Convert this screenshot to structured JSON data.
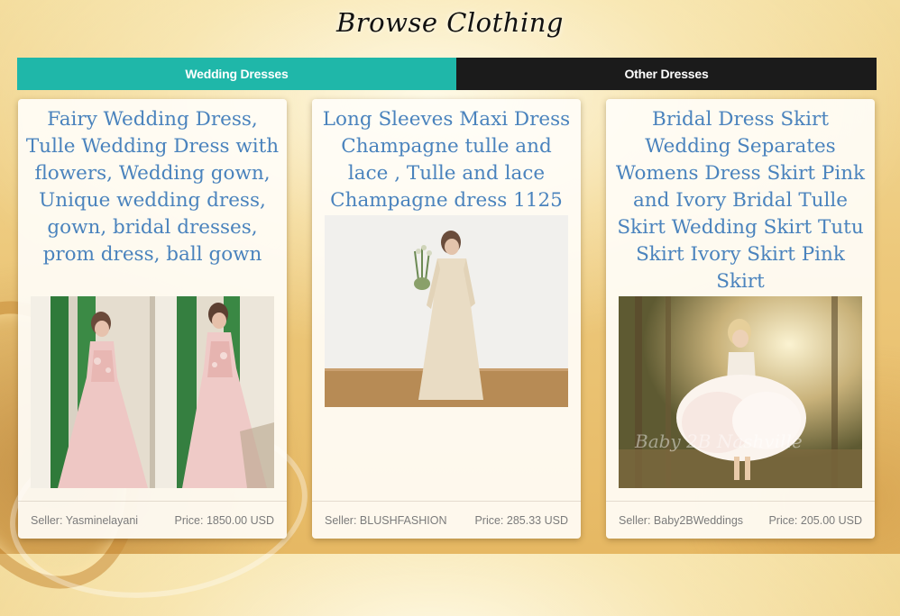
{
  "page": {
    "title": "Browse Clothing"
  },
  "tabs": [
    {
      "label": "Wedding Dresses",
      "active": true
    },
    {
      "label": "Other Dresses",
      "active": false
    }
  ],
  "colors": {
    "tab_active": "#1fb7a9",
    "tab_inactive": "#1b1b1b",
    "card_title": "#4a83bd",
    "footer_text": "#7b7b7b"
  },
  "listings": [
    {
      "title": "Fairy Wedding Dress, Tulle Wedding Dress with flowers, Wedding gown, Unique wedding dress, gown, bridal dresses, prom dress, ball gown",
      "image": "bride-in-pink-tulle-gown-photo",
      "seller_label": "Seller:",
      "seller": "Yasminelayani",
      "price_label": "Price:",
      "price": "1850.00 USD"
    },
    {
      "title": "Long Sleeves Maxi Dress Champagne tulle and lace , Tulle and lace Champagne dress 1125",
      "image": "bride-with-bouquet-champagne-dress-photo",
      "seller_label": "Seller:",
      "seller": "BLUSHFASHION",
      "price_label": "Price:",
      "price": "285.33 USD"
    },
    {
      "title": "Bridal Dress Skirt Wedding Separates Womens Dress Skirt Pink and Ivory Bridal Tulle Skirt Wedding Skirt Tutu Skirt Ivory Skirt Pink Skirt",
      "image": "bride-in-tutu-skirt-forest-photo",
      "image_watermark": "Baby 2B Nashville",
      "seller_label": "Seller:",
      "seller": "Baby2BWeddings",
      "price_label": "Price:",
      "price": "205.00 USD"
    }
  ]
}
